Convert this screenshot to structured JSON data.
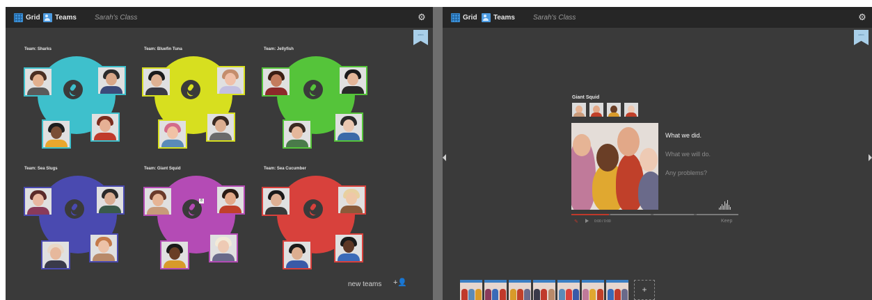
{
  "left_panel": {
    "topbar": {
      "grid_label": "Grid",
      "teams_label": "Teams",
      "class_name": "Sarah's Class"
    },
    "bookmark_label": "admin",
    "teams": [
      {
        "name": "Team: Sharks",
        "color": "#3ec0cc"
      },
      {
        "name": "Team: Bluefin Tuna",
        "color": "#d7df1f"
      },
      {
        "name": "Team: Jellyfish",
        "color": "#55c43a"
      },
      {
        "name": "Team: Sea Slugs",
        "color": "#4a4ab0"
      },
      {
        "name": "Team: Giant Squid",
        "color": "#b44bb5",
        "badge": "8"
      },
      {
        "name": "Team: Sea Cucumber",
        "color": "#d8413c"
      }
    ],
    "new_teams_label": "new teams",
    "add_person_label": "+👤"
  },
  "right_panel": {
    "topbar": {
      "grid_label": "Grid",
      "teams_label": "Teams",
      "class_name": "Sarah's Class"
    },
    "bookmark_label": "admin",
    "team_title": "Giant Squid",
    "questions": [
      {
        "text": "What we did.",
        "active": true
      },
      {
        "text": "What we will do.",
        "active": false
      },
      {
        "text": "Any problems?",
        "active": false
      }
    ],
    "time_display": "0:00 / 0:00",
    "keep_label": "Keep",
    "thumbnail_count": 7,
    "add_thumb_label": "+"
  },
  "icons": {
    "gear": "gear-icon",
    "grid": "grid-icon",
    "teams": "teams-icon",
    "mic": "microphone-icon",
    "record": "record-icon",
    "play": "play-icon"
  }
}
